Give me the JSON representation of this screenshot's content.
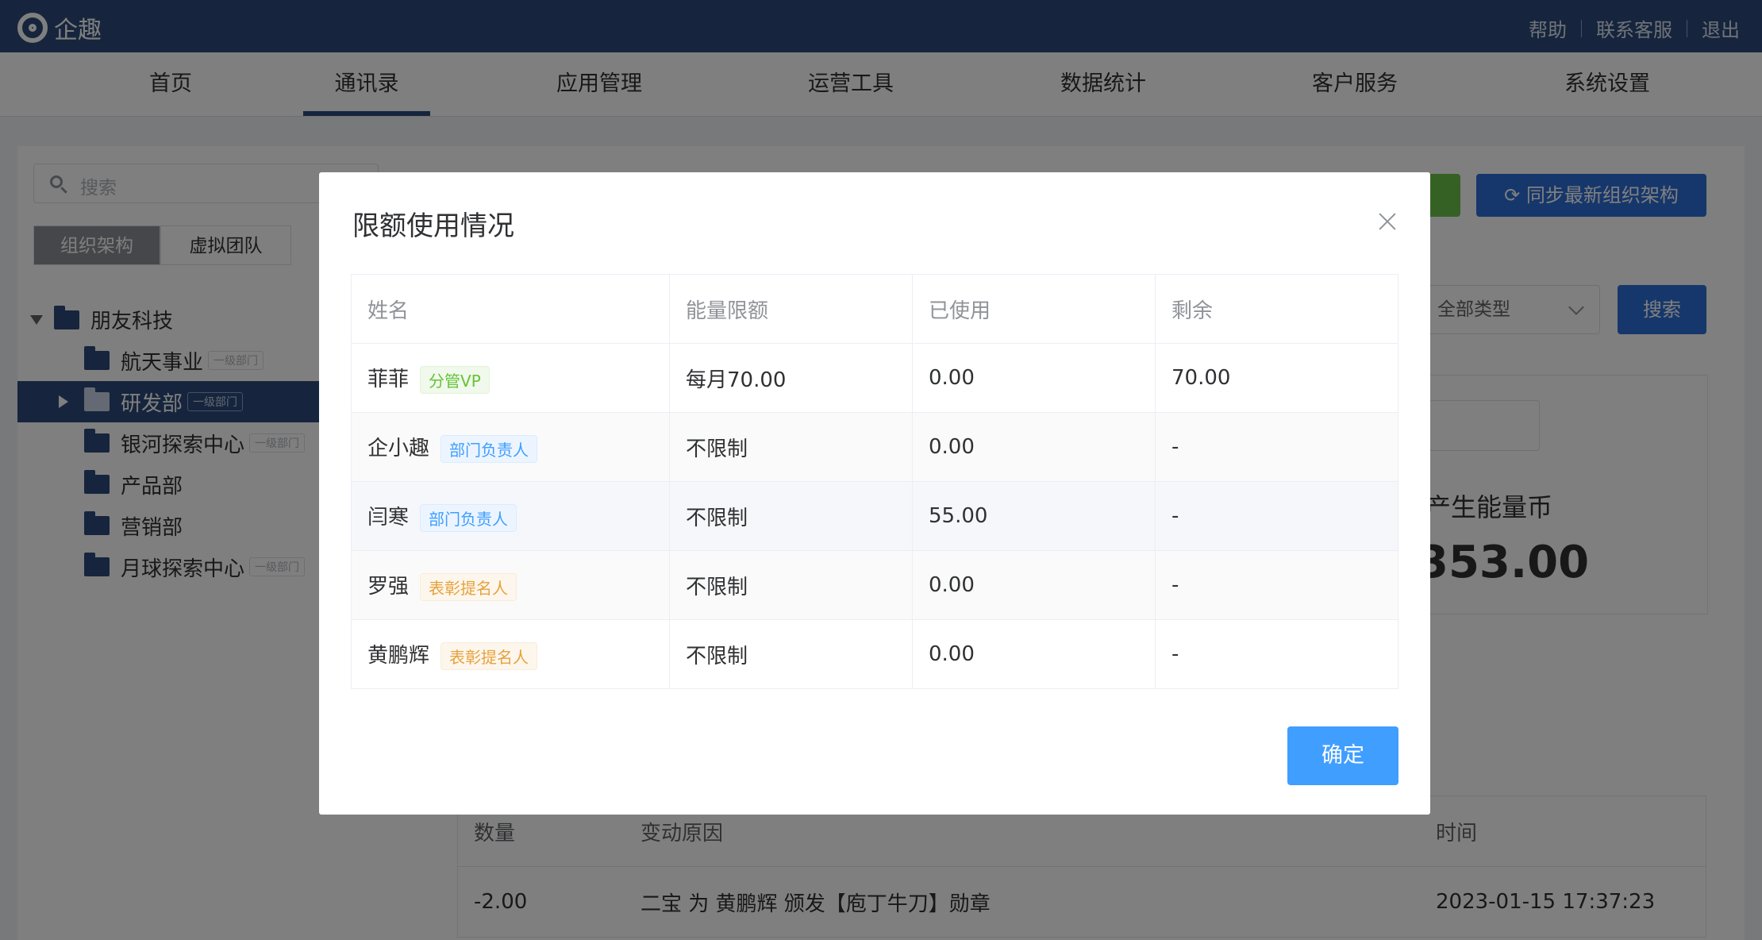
{
  "header": {
    "brand": "企趣",
    "links": [
      "帮助",
      "联系客服",
      "退出"
    ]
  },
  "nav": {
    "items": [
      "首页",
      "通讯录",
      "应用管理",
      "运营工具",
      "数据统计",
      "客户服务",
      "系统设置"
    ],
    "active": "通讯录"
  },
  "sidebar": {
    "search_placeholder": "搜索",
    "tabs": [
      "组织架构",
      "虚拟团队"
    ],
    "root": "朋友科技",
    "departments": [
      {
        "name": "航天事业",
        "tag": "一级部门"
      },
      {
        "name": "研发部",
        "tag": "一级部门"
      },
      {
        "name": "银河探索中心",
        "tag": "一级部门"
      },
      {
        "name": "产品部",
        "tag": ""
      },
      {
        "name": "营销部",
        "tag": ""
      },
      {
        "name": "月球探索中心",
        "tag": "一级部门"
      }
    ]
  },
  "main": {
    "sync_button": "同步最新组织架构",
    "type_select": "全部类型",
    "search_button": "搜索",
    "stat_label": "产生能量币",
    "stat_value": "353.00",
    "table_headers": [
      "数量",
      "变动原因",
      "时间"
    ],
    "table_rows": [
      {
        "amount": "-2.00",
        "reason": "二宝 为 黄鹏辉 颁发【庖丁牛刀】勋章",
        "time": "2023-01-15 17:37:23"
      }
    ]
  },
  "dialog": {
    "title": "限额使用情况",
    "headers": [
      "姓名",
      "能量限额",
      "已使用",
      "剩余"
    ],
    "rows": [
      {
        "name": "菲菲",
        "role": "分管VP",
        "limit": "每月70.00",
        "used": "0.00",
        "remaining": "70.00"
      },
      {
        "name": "企小趣",
        "role": "部门负责人",
        "limit": "不限制",
        "used": "0.00",
        "remaining": "-"
      },
      {
        "name": "闫寒",
        "role": "部门负责人",
        "limit": "不限制",
        "used": "55.00",
        "remaining": "-"
      },
      {
        "name": "罗强",
        "role": "表彰提名人",
        "limit": "不限制",
        "used": "0.00",
        "remaining": "-"
      },
      {
        "name": "黄鹏辉",
        "role": "表彰提名人",
        "limit": "不限制",
        "used": "0.00",
        "remaining": "-"
      }
    ],
    "confirm": "确定"
  }
}
